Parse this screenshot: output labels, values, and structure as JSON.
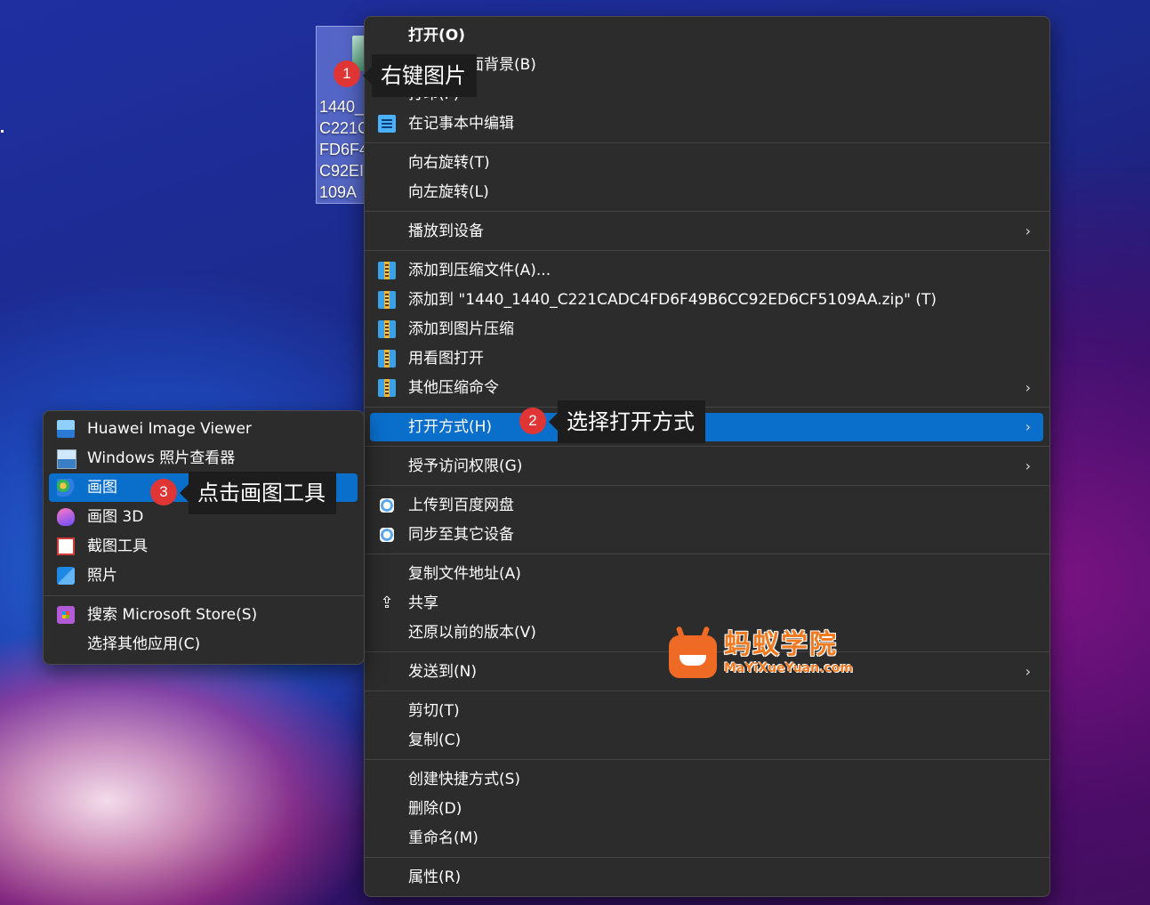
{
  "desktop": {
    "file_icon": {
      "name": "1440_\nC221C\nFD6F4\nC92EI\n109A"
    }
  },
  "context_menu": {
    "open": "打开(O)",
    "set_wallpaper": "设置为桌面背景(B)",
    "print": "打印(P)",
    "edit_notepad": "在记事本中编辑",
    "rotate_right": "向右旋转(T)",
    "rotate_left": "向左旋转(L)",
    "cast": "播放到设备",
    "add_archive": "添加到压缩文件(A)...",
    "add_to_zip": "添加到 \"1440_1440_C221CADC4FD6F49B6CC92ED6CF5109AA.zip\" (T)",
    "add_image_compress": "添加到图片压缩",
    "open_with_viewer": "用看图打开",
    "other_compress": "其他压缩命令",
    "open_with": "打开方式(H)",
    "give_access": "授予访问权限(G)",
    "upload_baidu": "上传到百度网盘",
    "sync_devices": "同步至其它设备",
    "copy_path": "复制文件地址(A)",
    "share": "共享",
    "restore_versions": "还原以前的版本(V)",
    "send_to": "发送到(N)",
    "cut": "剪切(T)",
    "copy": "复制(C)",
    "create_shortcut": "创建快捷方式(S)",
    "delete": "删除(D)",
    "rename": "重命名(M)",
    "properties": "属性(R)",
    "chevron": "›"
  },
  "open_with_menu": {
    "huawei_viewer": "Huawei Image Viewer",
    "windows_photo_viewer": "Windows 照片查看器",
    "paint": "画图",
    "paint3d": "画图 3D",
    "snipping": "截图工具",
    "photos": "照片",
    "search_store": "搜索 Microsoft Store(S)",
    "choose_other": "选择其他应用(C)"
  },
  "annotations": {
    "step1": {
      "num": "1",
      "text": "右键图片"
    },
    "step2": {
      "num": "2",
      "text": "选择打开方式"
    },
    "step3": {
      "num": "3",
      "text": "点击画图工具"
    }
  },
  "watermark": {
    "title": "蚂蚁学院",
    "subtitle": "MaYiXueYuan.com"
  },
  "icons": {
    "archive": "archive-icon",
    "notepad": "notepad-icon",
    "cloud": "baidu-cloud-icon",
    "share": "share-icon",
    "chevron": "chevron-right-icon"
  },
  "colors": {
    "highlight": "#0a6fcb",
    "menu_bg": "#2c2c2c",
    "badge": "#e03535",
    "callout_bg": "#1d1d1d"
  }
}
